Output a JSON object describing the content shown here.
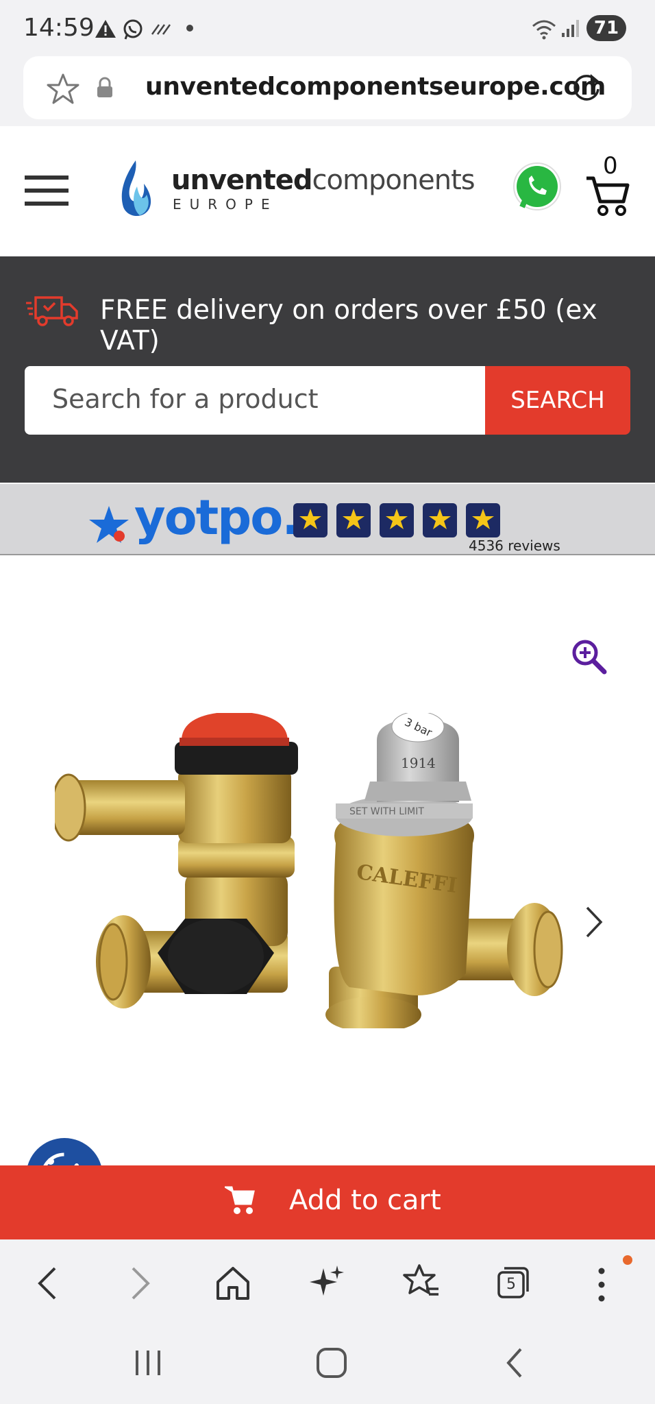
{
  "status_bar": {
    "time": "14:59",
    "battery": "71",
    "icons": [
      "warning-icon",
      "whatsapp-icon",
      "missed-call-icon",
      "dot-icon",
      "wifi-icon",
      "signal-icon",
      "battery-icon"
    ]
  },
  "browser": {
    "url": "unventedcomponentseurope.com",
    "tab_count": "5"
  },
  "site_header": {
    "logo_bold": "unvented",
    "logo_light": "components",
    "logo_sub": "EUROPE",
    "cart_count": "0"
  },
  "promo": {
    "delivery_text": "FREE delivery on orders over £50 (ex VAT)",
    "search_placeholder": "Search for a product",
    "search_button": "SEARCH"
  },
  "reviews_banner": {
    "brand": "yotpo.",
    "stars": 5,
    "reviews_text": "4536 reviews"
  },
  "product": {
    "cart_button": "Add to cart",
    "image_labels": {
      "cap": "3 bar",
      "number": "1914",
      "brand": "CALEFFI",
      "collar": "SET WITH LIMIT"
    }
  },
  "colors": {
    "accent_red": "#e33b2c",
    "dark_bar": "#3c3c3e",
    "yotpo_blue": "#1a6bd8",
    "star_navy": "#1d2a63",
    "star_gold": "#f5c518",
    "zoom_purple": "#5b1e9e"
  }
}
